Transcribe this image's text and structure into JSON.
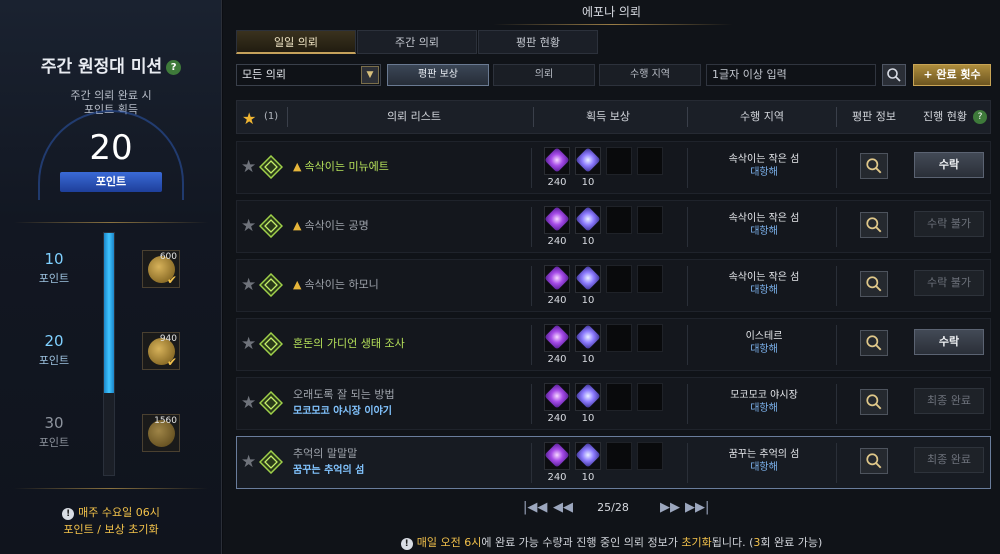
{
  "left": {
    "title": "주간 원정대 미션",
    "help": "?",
    "subtitle_line1": "주간 의뢰 완료 시",
    "subtitle_line2": "포인트 획득",
    "points": "20",
    "points_label": "포인트",
    "progress_fraction": 0.66,
    "tiers": [
      {
        "value": "10",
        "label": "포인트",
        "reward_amount": "600",
        "claimed": true
      },
      {
        "value": "20",
        "label": "포인트",
        "reward_amount": "940",
        "claimed": true
      },
      {
        "value": "30",
        "label": "포인트",
        "reward_amount": "1560",
        "claimed": false
      }
    ],
    "notice_line1": "매주 수요일 06시",
    "notice_line2": "포인트 / 보상 초기화",
    "notice_icon": "!"
  },
  "window_title": "에포나 의뢰",
  "tabs": [
    {
      "label": "일일 의뢰",
      "active": true
    },
    {
      "label": "주간 의뢰",
      "active": false
    },
    {
      "label": "평판 현황",
      "active": false
    }
  ],
  "toolbar": {
    "select_value": "모든 의뢰",
    "filters": [
      "평판 보상",
      "의뢰",
      "수행 지역"
    ],
    "active_filter": 0,
    "search_placeholder": "1글자 이상 입력",
    "complete_label": "+ 완료 횟수"
  },
  "header": {
    "count": "(1)",
    "columns": [
      "의뢰 리스트",
      "획득 보상",
      "수행 지역",
      "평판 정보",
      "진행 현황"
    ],
    "help": "?"
  },
  "quests": [
    {
      "title": "속삭이는 미뉴에트",
      "subtitle": "",
      "highlight": true,
      "fire": true,
      "reward1": "240",
      "reward2": "10",
      "region1": "속삭이는 작은 섬",
      "region2": "대항해",
      "action": "수락",
      "action_enabled": true,
      "selected": false
    },
    {
      "title": "속삭이는 공명",
      "subtitle": "",
      "highlight": false,
      "fire": true,
      "reward1": "240",
      "reward2": "10",
      "region1": "속삭이는 작은 섬",
      "region2": "대항해",
      "action": "수락 불가",
      "action_enabled": false,
      "selected": false
    },
    {
      "title": "속삭이는 하모니",
      "subtitle": "",
      "highlight": false,
      "fire": true,
      "reward1": "240",
      "reward2": "10",
      "region1": "속삭이는 작은 섬",
      "region2": "대항해",
      "action": "수락 불가",
      "action_enabled": false,
      "selected": false
    },
    {
      "title": "혼돈의 가디언 생태 조사",
      "subtitle": "",
      "highlight": true,
      "fire": false,
      "reward1": "240",
      "reward2": "10",
      "region1": "이스테르",
      "region2": "대항해",
      "action": "수락",
      "action_enabled": true,
      "selected": false
    },
    {
      "title": "오래도록 잘 되는 방법",
      "subtitle": "모코모코 야시장 이야기",
      "highlight": false,
      "fire": false,
      "reward1": "240",
      "reward2": "10",
      "region1": "모코모코 야시장",
      "region2": "대항해",
      "action": "최종 완료",
      "action_enabled": false,
      "selected": false
    },
    {
      "title": "추억의 말말말",
      "subtitle": "꿈꾸는 추억의 섬",
      "highlight": false,
      "fire": false,
      "reward1": "240",
      "reward2": "10",
      "region1": "꿈꾸는 추억의 섬",
      "region2": "대항해",
      "action": "최종 완료",
      "action_enabled": false,
      "selected": true
    }
  ],
  "pager": {
    "page": "25/28"
  },
  "footer": {
    "part1": "매일 오전 6시",
    "part2": "에 완료 가능 수량과 진행 중인 의뢰 정보가 ",
    "part3": "초기화",
    "part4": "됩니다. (",
    "part5": "3",
    "part6": "회 완료 가능)"
  },
  "colors": {
    "accent_gold": "#c4a15b",
    "highlight_green": "#b5e05a",
    "link_blue": "#82c4ff",
    "progress_blue": "#3fc4ff"
  }
}
